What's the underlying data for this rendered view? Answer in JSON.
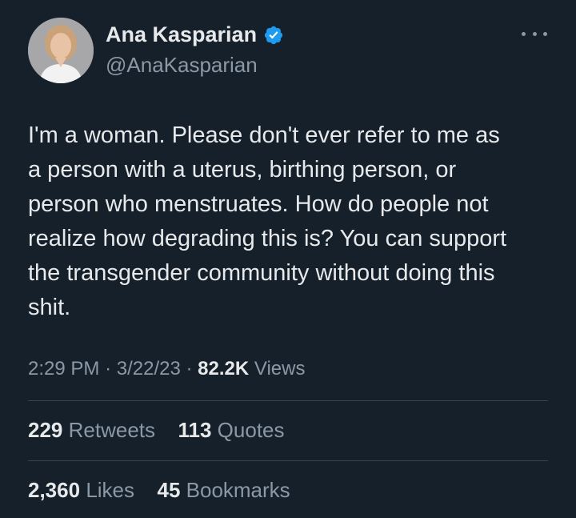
{
  "author": {
    "name": "Ana Kasparian",
    "handle": "@AnaKasparian",
    "verified_color": "#1d9bf0"
  },
  "tweet": {
    "text_lines": [
      "I'm a woman. Please don't ever refer to me as",
      "a person with a uterus, birthing person, or",
      "person who menstruates. How do people not",
      "realize how degrading this is? You can support",
      "the transgender community without doing this",
      "shit."
    ]
  },
  "meta": {
    "time": "2:29 PM",
    "separator": "·",
    "date": "3/22/23",
    "views_count": "82.2K",
    "views_label": "Views"
  },
  "stats": {
    "retweets_count": "229",
    "retweets_label": "Retweets",
    "quotes_count": "113",
    "quotes_label": "Quotes",
    "likes_count": "2,360",
    "likes_label": "Likes",
    "bookmarks_count": "45",
    "bookmarks_label": "Bookmarks"
  },
  "icons": {
    "avatar": "profile-photo",
    "verified": "verified-badge-icon",
    "more": "more-options-icon"
  },
  "colors": {
    "background": "#15202b",
    "primary_text": "#e7e9ea",
    "secondary_text": "#8b98a5",
    "divider": "#38444d"
  }
}
